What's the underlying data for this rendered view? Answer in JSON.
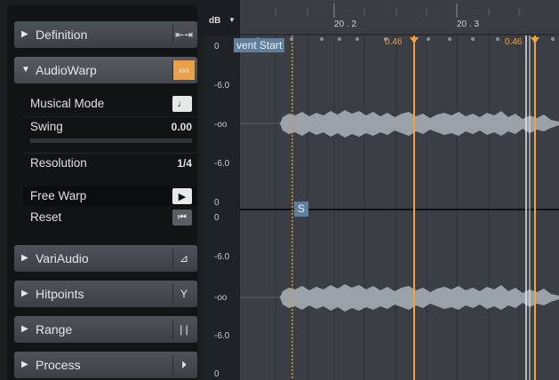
{
  "inspector": {
    "sections": [
      {
        "label": "Definition",
        "icon": "fit-width-icon",
        "expanded": false
      },
      {
        "label": "AudioWarp",
        "icon": "warp-orange-icon",
        "expanded": true
      },
      {
        "label": "VariAudio",
        "icon": "pitch-curve-icon",
        "expanded": false
      },
      {
        "label": "Hitpoints",
        "icon": "filter-icon",
        "expanded": false
      },
      {
        "label": "Range",
        "icon": "range-bars-icon",
        "expanded": false
      },
      {
        "label": "Process",
        "icon": "play-circle-icon",
        "expanded": false
      }
    ],
    "audiowarp": {
      "musical_mode": "Musical Mode",
      "swing": "Swing",
      "swing_value": "0.00",
      "resolution": "Resolution",
      "resolution_value": "1/4",
      "free_warp": "Free Warp",
      "reset": "Reset"
    }
  },
  "ruler": {
    "db_label": "dB",
    "marks": [
      "20 . 2",
      "20 . 3"
    ],
    "event_start": "vent Start",
    "warp_labels": [
      "0.46",
      "0.46"
    ],
    "snap_label": "S"
  },
  "scale": {
    "labels": [
      "0",
      "-6.0",
      "-oo",
      "-6.0",
      "0",
      "0",
      "-6.0",
      "-oo",
      "-6.0",
      "0"
    ]
  },
  "colors": {
    "accent": "#f3a436",
    "waveform": "#9aa1a8",
    "event_start_bg": "#5f7f9c"
  }
}
